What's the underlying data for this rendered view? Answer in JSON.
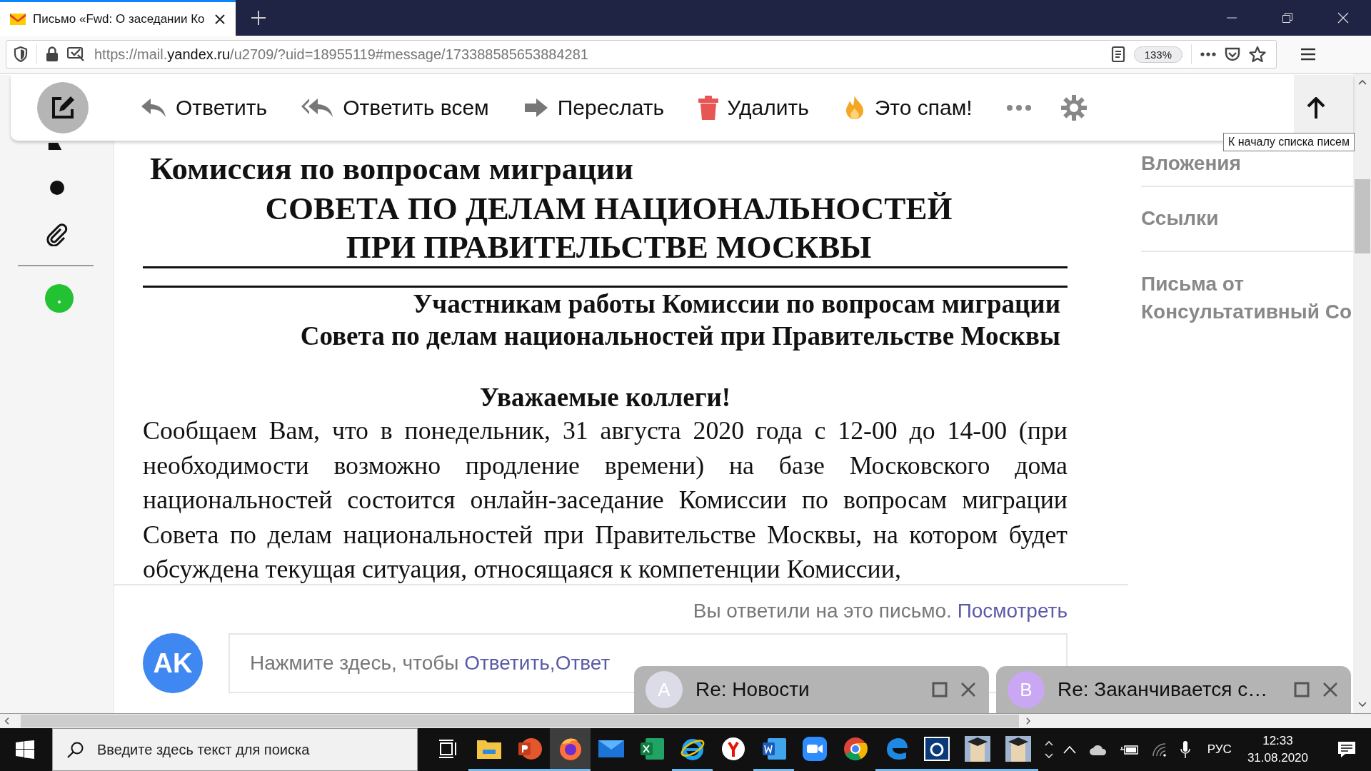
{
  "browser": {
    "tab": {
      "title": "Письмо «Fwd: О заседании Ко",
      "selected": true
    },
    "address": {
      "prefix": "https://mail.",
      "domain": "yandex.ru",
      "path": "/u2709/?uid=18955119#message/173388585653884281"
    },
    "zoom": "133%"
  },
  "toolbar": {
    "actions": [
      {
        "kind": "reply",
        "label": "Ответить"
      },
      {
        "kind": "reply_all",
        "label": "Ответить всем"
      },
      {
        "kind": "forward",
        "label": "Переслать"
      },
      {
        "kind": "delete",
        "label": "Удалить"
      },
      {
        "kind": "spam",
        "label": "Это спам!"
      }
    ]
  },
  "tooltip": "К началу списка писем",
  "letter": {
    "org": "Комиссия по вопросам миграции",
    "council": [
      "СОВЕТА ПО ДЕЛАМ НАЦИОНАЛЬНОСТЕЙ",
      "ПРИ ПРАВИТЕЛЬСТВЕ МОСКВЫ"
    ],
    "addressee": [
      "Участникам работы Комиссии по вопросам миграции",
      "Совета по делам национальностей при Правительстве Москвы"
    ],
    "greeting": "Уважаемые коллеги!",
    "body": "Сообщаем Вам, что в понедельник, 31 августа 2020 года с 12-00 до 14-00 (при необходимости возможно продление времени) на базе Московского дома национальностей состоится онлайн-заседание Комиссии по вопросам миграции Совета по делам национальностей при Правительстве Москвы, на котором будет обсуждена текущая ситуация, относящаяся к компетенции Комиссии,"
  },
  "reply": {
    "notice": "Вы ответили на это письмо.",
    "notice_link": "Посмотреть",
    "avatar": "AK",
    "prompt": "Нажмите здесь, чтобы",
    "links": [
      "Ответить,",
      "Ответ"
    ]
  },
  "side_panel": {
    "items": [
      "Вложения",
      "Ссылки",
      "Письма от Консультативный Со"
    ]
  },
  "mini_windows": [
    {
      "avatar": "A",
      "color": "#dcdce8",
      "title": "Re: Новости"
    },
    {
      "avatar": "B",
      "color": "#c9a7f2",
      "title": "Re: Заканчивается с…"
    }
  ],
  "taskbar": {
    "search_placeholder": "Введите здесь текст для поиска",
    "apps": [
      {
        "kind": "taskview",
        "running": false,
        "selected": false
      },
      {
        "kind": "folder",
        "running": true,
        "selected": false
      },
      {
        "kind": "powerpoint",
        "running": true,
        "selected": false
      },
      {
        "kind": "firefox",
        "running": true,
        "selected": true
      },
      {
        "kind": "mail",
        "running": false,
        "selected": false
      },
      {
        "kind": "excel",
        "running": false,
        "selected": false
      },
      {
        "kind": "ie",
        "running": true,
        "selected": false
      },
      {
        "kind": "yandex",
        "running": false,
        "selected": false
      },
      {
        "kind": "word",
        "running": true,
        "selected": false
      },
      {
        "kind": "zoom",
        "running": false,
        "selected": false
      },
      {
        "kind": "chrome",
        "running": false,
        "selected": false
      },
      {
        "kind": "edge",
        "running": true,
        "selected": false
      },
      {
        "kind": "camera",
        "running": true,
        "selected": false
      },
      {
        "kind": "portrait",
        "running": true,
        "selected": false
      },
      {
        "kind": "portrait",
        "running": true,
        "selected": false
      }
    ],
    "language": "РУС",
    "time": "12:33",
    "date": "31.08.2020"
  }
}
